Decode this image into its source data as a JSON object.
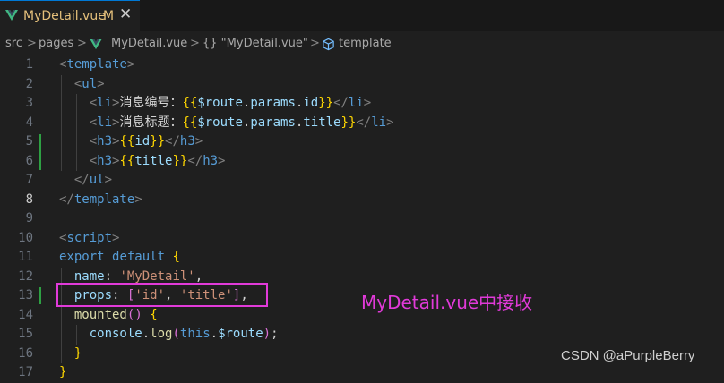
{
  "tab": {
    "filename": "MyDetail.vue",
    "status": "M",
    "close": "✕"
  },
  "breadcrumb": {
    "items": [
      "src",
      "pages",
      "MyDetail.vue",
      "{} \"MyDetail.vue\"",
      "template"
    ],
    "sep": ">"
  },
  "editor": {
    "line_numbers": [
      "1",
      "2",
      "3",
      "4",
      "5",
      "6",
      "7",
      "8",
      "9",
      "10",
      "11",
      "12",
      "13",
      "14",
      "15",
      "16",
      "17"
    ],
    "active_line": "8",
    "lines": [
      "<template>",
      "  <ul>",
      "    <li>消息编号：{{$route.params.id}}</li>",
      "    <li>消息标题：{{$route.params.title}}</li>",
      "    <h3>{{id}}</h3>",
      "    <h3>{{title}}</h3>",
      "  </ul>",
      "</template>",
      "",
      "<script>",
      "export default {",
      "  name: 'MyDetail',",
      "  props: ['id', 'title'],",
      "  mounted() {",
      "    console.log(this.$route);",
      "  }",
      "}"
    ]
  },
  "annotation": "MyDetail.vue中接收",
  "watermark": "CSDN @aPurpleBerry",
  "colors": {
    "accent": "#e13ad9",
    "modified": "#e5c07b",
    "git_added": "#2ea043"
  }
}
